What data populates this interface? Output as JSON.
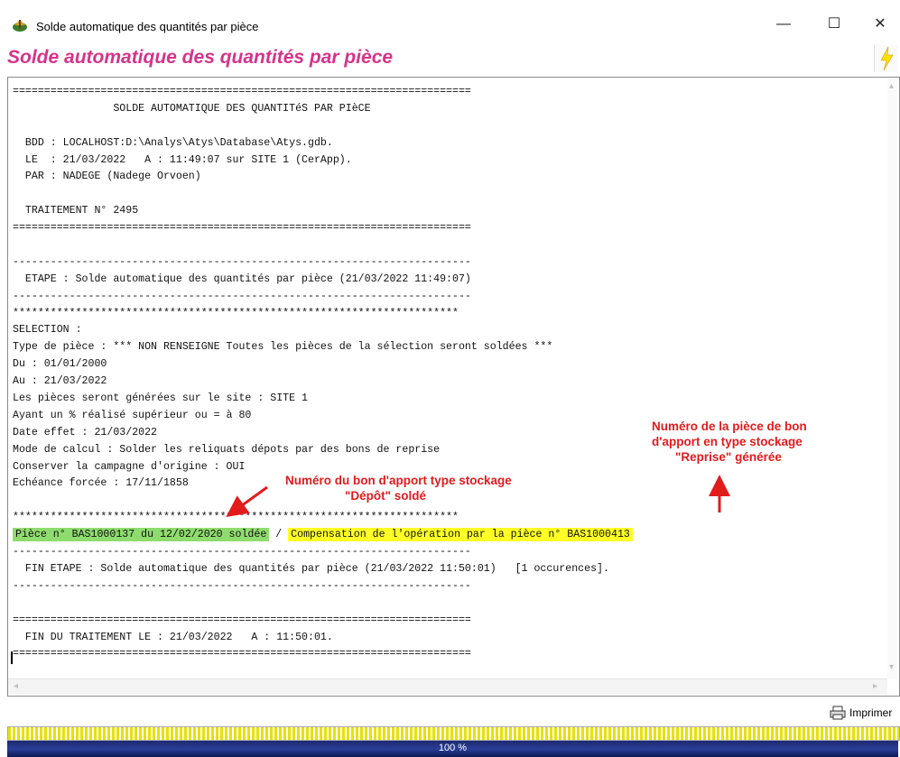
{
  "window": {
    "title": "Solde automatique des quantités par pièce",
    "controls": {
      "minimize": "—",
      "maximize": "☐",
      "close": "✕"
    }
  },
  "header": {
    "title": "Solde automatique des quantités par pièce",
    "icon": "lightning-icon"
  },
  "log": {
    "lines": [
      "=========================================================================",
      "                SOLDE AUTOMATIQUE DES QUANTITéS PAR PIèCE",
      "",
      "  BDD : LOCALHOST:D:\\Analys\\Atys\\Database\\Atys.gdb.",
      "  LE  : 21/03/2022   A : 11:49:07 sur SITE 1 (CerApp).",
      "  PAR : NADEGE (Nadege Orvoen)",
      "",
      "  TRAITEMENT N° 2495",
      "=========================================================================",
      "",
      "-------------------------------------------------------------------------",
      "  ETAPE : Solde automatique des quantités par pièce (21/03/2022 11:49:07)",
      "-------------------------------------------------------------------------",
      "***********************************************************************",
      "SELECTION :",
      "Type de pièce : *** NON RENSEIGNE Toutes les pièces de la sélection seront soldées ***",
      "Du : 01/01/2000",
      "Au : 21/03/2022",
      "Les pièces seront générées sur le site : SITE 1",
      "Ayant un % réalisé supérieur ou = à 80",
      "Date effet : 21/03/2022",
      "Mode de calcul : Solder les reliquats dépots par des bons de reprise",
      "Conserver la campagne d'origine : OUI",
      "Echéance forcée : 17/11/1858",
      "",
      "***********************************************************************"
    ],
    "highlight": {
      "green": "Pièce n° BAS1000137 du 12/02/2020 soldée",
      "sep": " / ",
      "yellow": "Compensation de l'opération par la pièce n° BAS1000413"
    },
    "after_lines": [
      "-------------------------------------------------------------------------",
      "  FIN ETAPE : Solde automatique des quantités par pièce (21/03/2022 11:50:01)   [1 occurences].",
      "-------------------------------------------------------------------------",
      "",
      "=========================================================================",
      "  FIN DU TRAITEMENT LE : 21/03/2022   A : 11:50:01.",
      "========================================================================="
    ]
  },
  "annotations": {
    "left": [
      "Numéro du bon d'apport type stockage",
      "\"Dépôt\" soldé"
    ],
    "right": [
      "Numéro de la pièce de bon",
      "d'apport en type stockage",
      "\"Reprise\" générée"
    ],
    "color": "#e21b1b"
  },
  "footer": {
    "print_label": "Imprimer",
    "print_icon": "printer-icon"
  },
  "progress": {
    "value": 1.0,
    "label": "100 %"
  }
}
